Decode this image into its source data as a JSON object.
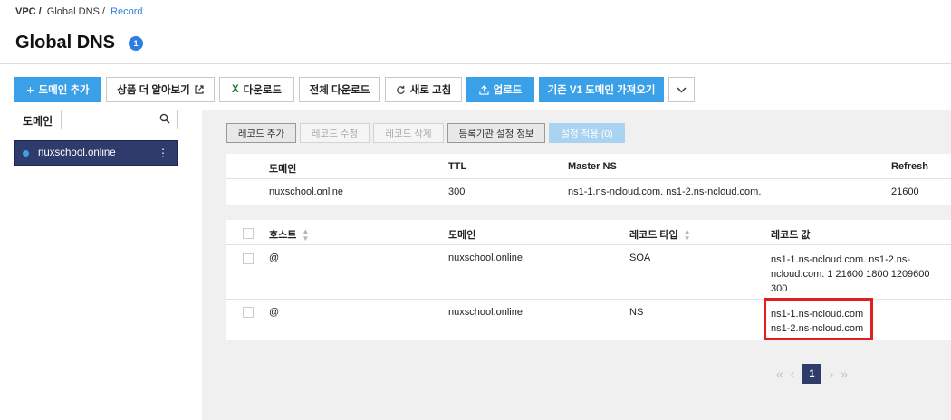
{
  "breadcrumb": {
    "vpc": "VPC /",
    "global_dns": "Global DNS /",
    "record": "Record"
  },
  "page": {
    "title": "Global DNS",
    "badge": "1"
  },
  "toolbar": {
    "add_domain": "도메인 추가",
    "learn_more": "상품 더 알아보기",
    "download": "다운로드",
    "download_all": "전체 다운로드",
    "refresh": "새로 고침",
    "upload": "업로드",
    "import_v1": "기존 V1 도메인 가져오기"
  },
  "sidebar": {
    "label": "도메인",
    "search_placeholder": "",
    "domain": "nuxschool.online"
  },
  "record_toolbar": {
    "add": "레코드 추가",
    "edit": "레코드 수정",
    "delete": "레코드 삭제",
    "registrar_info": "등록기관 설정 정보",
    "apply": "설정 적용 (0)"
  },
  "domain_table": {
    "headers": {
      "domain": "도메인",
      "ttl": "TTL",
      "master_ns": "Master NS",
      "refresh": "Refresh"
    },
    "row": {
      "domain": "nuxschool.online",
      "ttl": "300",
      "master_ns": "ns1-1.ns-ncloud.com. ns1-2.ns-ncloud.com.",
      "refresh": "21600"
    }
  },
  "record_table": {
    "headers": {
      "host": "호스트",
      "domain": "도메인",
      "type": "레코드 타입",
      "value": "레코드 값"
    },
    "rows": [
      {
        "host": "@",
        "domain": "nuxschool.online",
        "type": "SOA",
        "value_lines": [
          "ns1-1.ns-ncloud.com. ns1-2.ns-",
          "ncloud.com. 1 21600 1800 1209600",
          "300"
        ]
      },
      {
        "host": "@",
        "domain": "nuxschool.online",
        "type": "NS",
        "value_lines": [
          "ns1-1.ns-ncloud.com",
          "ns1-2.ns-ncloud.com"
        ]
      }
    ]
  },
  "pagination": {
    "current": "1"
  },
  "colors": {
    "primary": "#3aa0e8",
    "selected_bg": "#2e3b6b",
    "highlight": "#e02020"
  }
}
